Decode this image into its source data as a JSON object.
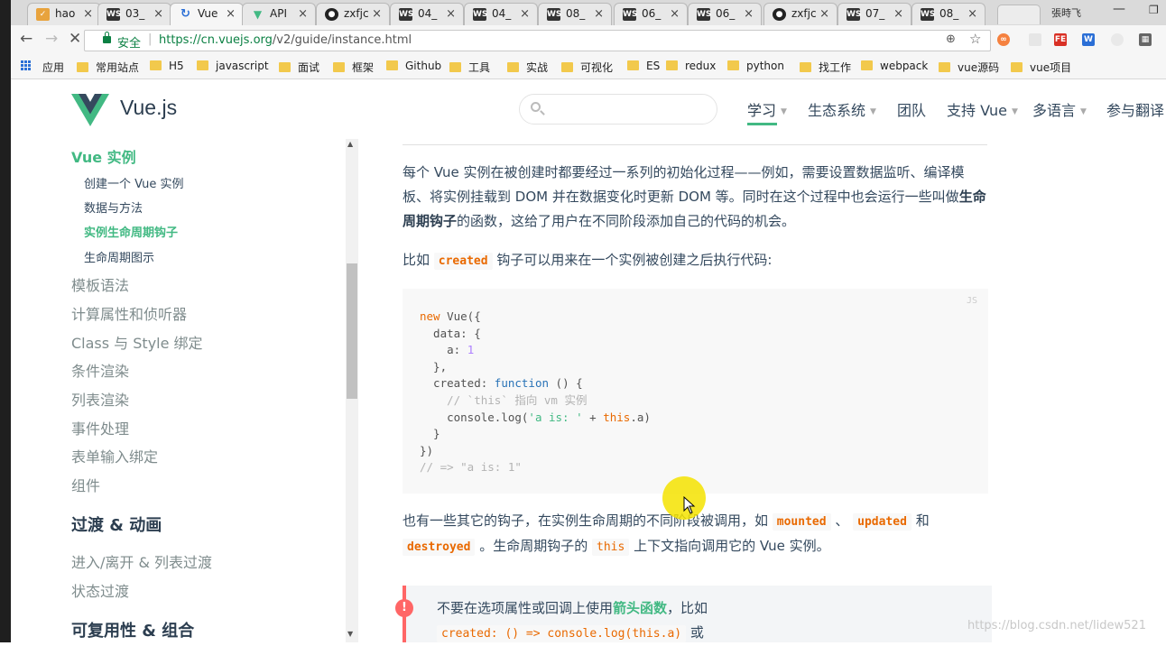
{
  "browser": {
    "tabs": [
      {
        "label": "hao",
        "icon": "folder-check-icon",
        "color": "#e8a33d"
      },
      {
        "label": "03_",
        "icon": "webstorm-icon",
        "color": "#333"
      },
      {
        "label": "Vue",
        "icon": "loading-icon",
        "color": "#2b6fd6"
      },
      {
        "label": "API",
        "icon": "vue-icon",
        "color": "#42b983"
      },
      {
        "label": "zxfjc",
        "icon": "github-icon",
        "color": "#222"
      },
      {
        "label": "04_",
        "icon": "webstorm-icon",
        "color": "#333"
      },
      {
        "label": "04_",
        "icon": "webstorm-icon",
        "color": "#333"
      },
      {
        "label": "08_",
        "icon": "webstorm-icon",
        "color": "#333"
      },
      {
        "label": "06_",
        "icon": "webstorm-icon",
        "color": "#333"
      },
      {
        "label": "06_",
        "icon": "webstorm-icon",
        "color": "#333"
      },
      {
        "label": "zxfjc",
        "icon": "github-icon",
        "color": "#222"
      },
      {
        "label": "07_",
        "icon": "webstorm-icon",
        "color": "#333"
      },
      {
        "label": "08_",
        "icon": "webstorm-icon",
        "color": "#333"
      }
    ],
    "user_label": "張時飞",
    "secure_label": "安全",
    "url_host": "https://cn.vuejs.org",
    "url_path": "/v2/guide/instance.html",
    "bookmarks": [
      "应用",
      "常用站点",
      "H5",
      "javascript",
      "面试",
      "框架",
      "Github",
      "工具",
      "实战",
      "可视化",
      "ES",
      "redux",
      "python",
      "找工作",
      "webpack",
      "vue源码",
      "vue项目"
    ]
  },
  "site": {
    "title": "Vue.js",
    "nav": [
      "学习",
      "生态系统",
      "团队",
      "支持 Vue",
      "多语言",
      "参与翻译"
    ]
  },
  "sidebar": {
    "current_section": "Vue 实例",
    "sub_items": [
      "创建一个 Vue 实例",
      "数据与方法",
      "实例生命周期钩子",
      "生命周期图示"
    ],
    "items": [
      "模板语法",
      "计算属性和侦听器",
      "Class 与 Style 绑定",
      "条件渲染",
      "列表渲染",
      "事件处理",
      "表单输入绑定",
      "组件"
    ],
    "heading_transition": "过渡 & 动画",
    "transition_items": [
      "进入/离开 & 列表过渡",
      "状态过渡"
    ],
    "heading_reuse": "可复用性 & 组合"
  },
  "content": {
    "p1_a": "每个 Vue 实例在被创建时都要经过一系列的初始化过程——例如，需要设置数据监听、编译模板、将实例挂载到 DOM 并在数据变化时更新 DOM 等。同时在这个过程中也会运行一些叫做",
    "p1_bold": "生命周期钩子",
    "p1_b": "的函数，这给了用户在不同阶段添加自己的代码的机会。",
    "p2_a": "比如 ",
    "p2_code": "created",
    "p2_b": " 钩子可以用来在一个实例被创建之后执行代码:",
    "code_lang": "JS",
    "p3_a": "也有一些其它的钩子，在实例生命周期的不同阶段被调用，如 ",
    "p3_code1": "mounted",
    "p3_sep": " 、 ",
    "p3_code2": "updated",
    "p3_and": " 和",
    "p3_code3": "destroyed",
    "p3_b": " 。生命周期钩子的 ",
    "p3_code4": "this",
    "p3_c": " 上下文指向调用它的 Vue 实例。",
    "tip_a": "不要在选项属性或回调上使用",
    "tip_bold": "箭头函数",
    "tip_b": "，比如",
    "tip_code": "created: () => console.log(this.a)",
    "tip_c": " 或"
  },
  "watermark": "https://blog.csdn.net/lidew521"
}
